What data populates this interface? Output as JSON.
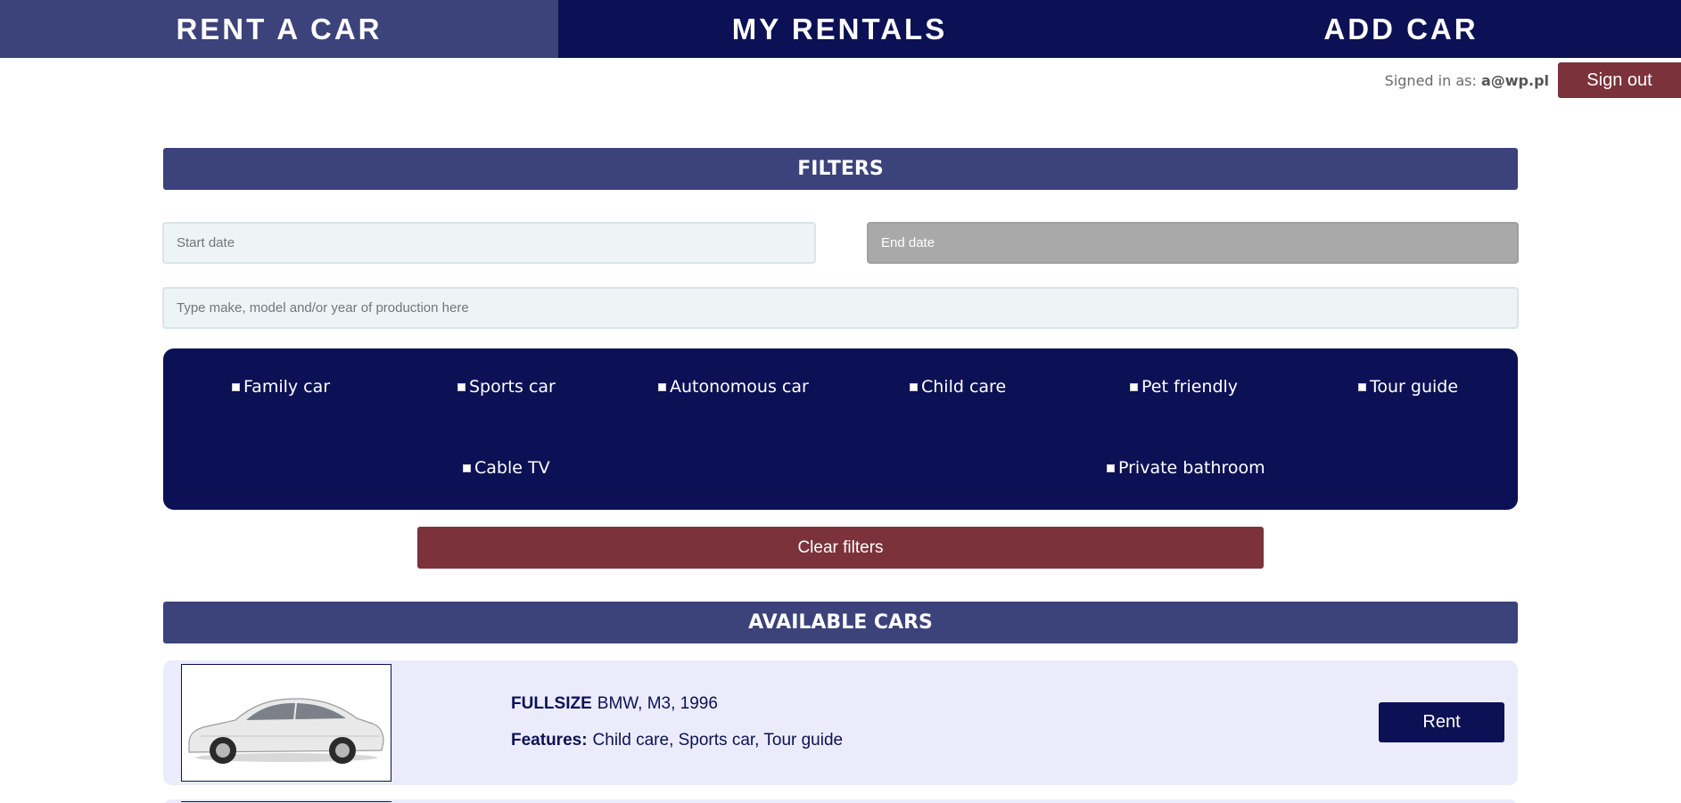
{
  "nav": {
    "tabs": [
      {
        "label": "RENT A CAR",
        "active": true
      },
      {
        "label": "MY RENTALS",
        "active": false
      },
      {
        "label": "ADD CAR",
        "active": false
      }
    ]
  },
  "user": {
    "signed_in_label": "Signed in as:",
    "email": "a@wp.pl",
    "sign_out_label": "Sign out"
  },
  "filters": {
    "title": "FILTERS",
    "start_date_placeholder": "Start date",
    "end_date_placeholder": "End date",
    "search_placeholder": "Type make, model and/or year of production here",
    "features": [
      "Family car",
      "Sports car",
      "Autonomous car",
      "Child care",
      "Pet friendly",
      "Tour guide",
      "Cable TV",
      "Private bathroom"
    ],
    "clear_label": "Clear filters"
  },
  "cars": {
    "title": "AVAILABLE CARS",
    "items": [
      {
        "category": "FULLSIZE",
        "description": "BMW, M3, 1996",
        "features_label": "Features:",
        "features": "Child care, Sports car, Tour guide",
        "rent_label": "Rent",
        "image_icon": "car-photo-icon"
      }
    ]
  },
  "colors": {
    "navy": "#0c1155",
    "header_blue": "#3c427a",
    "maroon": "#7b323a",
    "card_bg": "#ebebfb"
  }
}
